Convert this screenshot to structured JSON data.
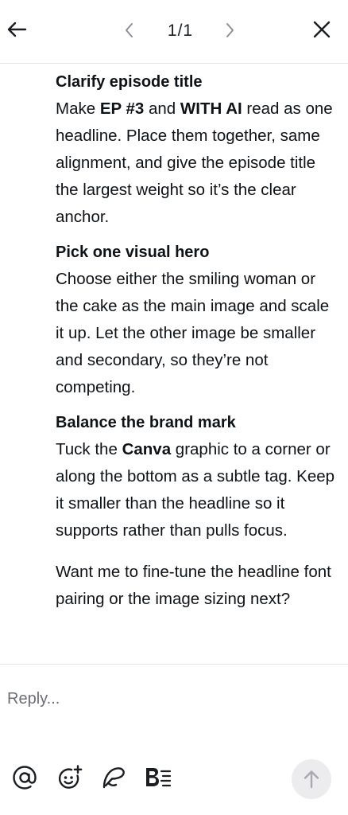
{
  "header": {
    "pager": "1/1",
    "icons": [
      "arrow-left-icon",
      "chevron-left-icon",
      "chevron-right-icon",
      "close-icon"
    ]
  },
  "message": {
    "sections": [
      {
        "title": "Clarify episode title",
        "segments": [
          {
            "text": "Make ",
            "bold": false
          },
          {
            "text": "EP #3",
            "bold": true
          },
          {
            "text": " and ",
            "bold": false
          },
          {
            "text": "WITH AI",
            "bold": true
          },
          {
            "text": " read as one headline. Place them together, same alignment, and give the episode title the largest weight so it’s the clear anchor.",
            "bold": false
          }
        ]
      },
      {
        "title": "Pick one visual hero",
        "segments": [
          {
            "text": "Choose either the smiling woman or the cake as the main image and scale it up. Let the other image be smaller and secondary, so they’re not competing.",
            "bold": false
          }
        ]
      },
      {
        "title": "Balance the brand mark",
        "segments": [
          {
            "text": "Tuck the ",
            "bold": false
          },
          {
            "text": "Canva",
            "bold": true
          },
          {
            "text": " graphic to a corner or along the bottom as a subtle tag. Keep it smaller than the headline so it supports rather than pulls focus.",
            "bold": false
          }
        ]
      }
    ],
    "closing": "Want me to fine-tune the headline font pairing or the image sizing next?"
  },
  "reply": {
    "placeholder": "Reply...",
    "value": ""
  },
  "toolbar": {
    "icons": [
      "mention-icon",
      "emoji-add-icon",
      "draw-icon",
      "text-format-icon"
    ],
    "send_icon": "arrow-up-icon"
  },
  "colors": {
    "text": "#0e1318",
    "divider": "#e3e3e6",
    "send_bg": "#ececef",
    "icon": "#1a1d22",
    "placeholder": "#6b6f76"
  }
}
